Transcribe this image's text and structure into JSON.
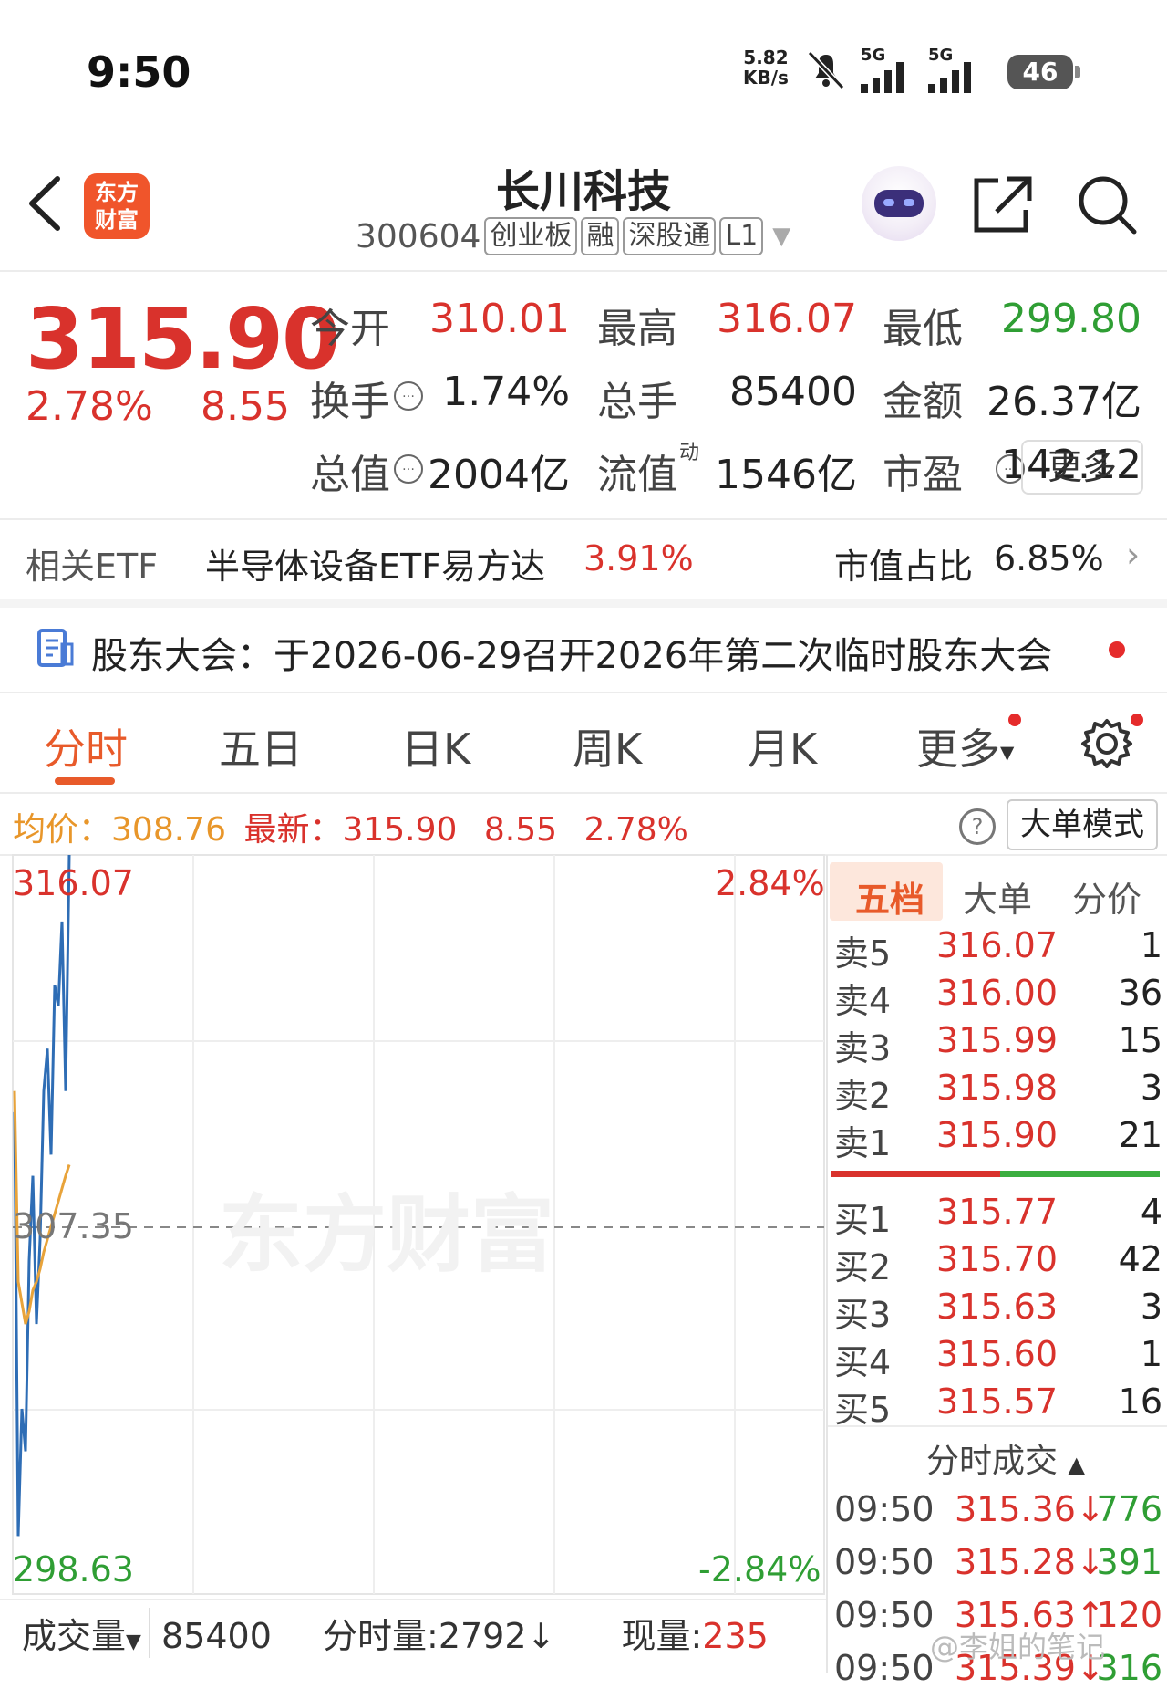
{
  "status_bar": {
    "time": "9:50",
    "net_speed_value": "5.82",
    "net_speed_unit": "KB/s",
    "signal1_label": "5G",
    "signal2_label": "5G",
    "battery": "46"
  },
  "header": {
    "app_logo_line1": "东方",
    "app_logo_line2": "财富",
    "stock_name": "长川科技",
    "stock_code": "300604",
    "tags": [
      "创业板",
      "融",
      "深股通",
      "L1"
    ]
  },
  "quote": {
    "last_price": "315.90",
    "change_pct": "2.78%",
    "change_amt": "8.55",
    "rows": [
      [
        {
          "label": "今开",
          "value": "310.01",
          "color": "red"
        },
        {
          "label": "最高",
          "value": "316.07",
          "color": "red"
        },
        {
          "label": "最低",
          "value": "299.80",
          "color": "green"
        }
      ],
      [
        {
          "label": "换手",
          "value": "1.74%",
          "color": "dark"
        },
        {
          "label": "总手",
          "value": "85400",
          "color": "dark"
        },
        {
          "label": "金额",
          "value": "26.37亿",
          "color": "dark"
        }
      ],
      [
        {
          "label": "总值",
          "value": "2004亿",
          "color": "dark"
        },
        {
          "label": "流值",
          "value": "1546亿",
          "color": "dark"
        },
        {
          "label": "市盈",
          "value": "142.12",
          "color": "dark"
        }
      ]
    ],
    "pe_superscript": "动",
    "more_label": "更多"
  },
  "etf": {
    "label": "相关ETF",
    "name": "半导体设备ETF易方达",
    "pct": "3.91%",
    "share_label": "市值占比",
    "share_value": "6.85%"
  },
  "notice": {
    "text": "股东大会：于2026-06-29召开2026年第二次临时股东大会"
  },
  "tabs": [
    "分时",
    "五日",
    "日K",
    "周K",
    "月K",
    "更多"
  ],
  "chart_info": {
    "avg_label": "均价：",
    "avg_value": "308.76",
    "latest_label": "最新：",
    "latest_value": "315.90",
    "latest_chg": "8.55",
    "latest_pct": "2.78%",
    "mode_button": "大单模式"
  },
  "chart_data": {
    "type": "line",
    "y_max": "316.07",
    "y_mid": "307.35",
    "y_min": "298.63",
    "pct_max": "2.84%",
    "pct_min": "-2.84%",
    "watermark": "东方财富",
    "ylim": [
      298.63,
      316.07
    ],
    "series": [
      {
        "values": [
          310.0,
          300.0,
          303.0,
          302.0,
          306.5,
          308.5,
          305.0,
          307.0,
          310.5,
          311.5,
          309.0,
          313.0,
          312.5,
          314.5,
          310.5,
          316.07
        ]
      },
      {
        "values": [
          310.5,
          306.0,
          305.5,
          305.0,
          305.3,
          305.8,
          306.0,
          306.3,
          306.7,
          307.0,
          307.3,
          307.6,
          307.9,
          308.2,
          308.5,
          308.76
        ]
      }
    ]
  },
  "order_book": {
    "tabs": [
      "五档",
      "大单",
      "分价"
    ],
    "asks": [
      {
        "label": "卖5",
        "price": "316.07",
        "vol": "1"
      },
      {
        "label": "卖4",
        "price": "316.00",
        "vol": "36"
      },
      {
        "label": "卖3",
        "price": "315.99",
        "vol": "15"
      },
      {
        "label": "卖2",
        "price": "315.98",
        "vol": "3"
      },
      {
        "label": "卖1",
        "price": "315.90",
        "vol": "21"
      }
    ],
    "bids": [
      {
        "label": "买1",
        "price": "315.77",
        "vol": "4"
      },
      {
        "label": "买2",
        "price": "315.70",
        "vol": "42"
      },
      {
        "label": "买3",
        "price": "315.63",
        "vol": "3"
      },
      {
        "label": "买4",
        "price": "315.60",
        "vol": "1"
      },
      {
        "label": "买5",
        "price": "315.57",
        "vol": "16"
      }
    ]
  },
  "trades": {
    "title": "分时成交",
    "items": [
      {
        "time": "09:50",
        "price": "315.36↓",
        "vol": "776"
      },
      {
        "time": "09:50",
        "price": "315.28↓",
        "vol": "391"
      },
      {
        "time": "09:50",
        "price": "315.63↑",
        "vol": "120"
      },
      {
        "time": "09:50",
        "price": "315.39↓",
        "vol": "316"
      }
    ]
  },
  "volume_bar": {
    "selector": "成交量",
    "value": "85400",
    "minute_label": "分时量:",
    "minute_value": "2792↓",
    "now_label": "现量:",
    "now_value": "235"
  },
  "watermark_text": "@李姐的笔记"
}
